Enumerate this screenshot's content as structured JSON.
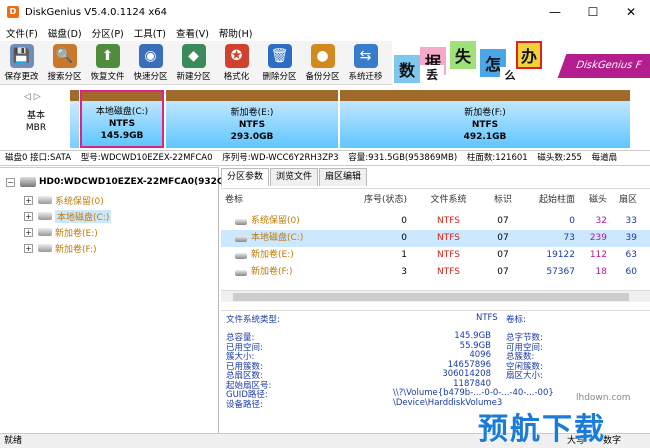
{
  "window": {
    "title": "DiskGenius V5.4.0.1124 x64",
    "app_icon": "D",
    "controls": [
      "—",
      "☐",
      "✕"
    ]
  },
  "menu": [
    "文件(F)",
    "磁盘(D)",
    "分区(P)",
    "工具(T)",
    "查看(V)",
    "帮助(H)"
  ],
  "toolbar": [
    {
      "label": "保存更改",
      "icon": "save-icon",
      "color": "#6f8fb8",
      "glyph": "💾"
    },
    {
      "label": "搜索分区",
      "icon": "magnifier-icon",
      "color": "#c9782c",
      "glyph": "🔍"
    },
    {
      "label": "恢复文件",
      "icon": "recover-icon",
      "color": "#4f8d3a",
      "glyph": "⬆"
    },
    {
      "label": "快速分区",
      "icon": "quick-partition-icon",
      "color": "#3a6fb8",
      "glyph": "◉"
    },
    {
      "label": "新建分区",
      "icon": "new-partition-icon",
      "color": "#3b8b5a",
      "glyph": "◆"
    },
    {
      "label": "格式化",
      "icon": "format-icon",
      "color": "#d0422e",
      "glyph": "✪"
    },
    {
      "label": "删除分区",
      "icon": "delete-icon",
      "color": "#2d6ec4",
      "glyph": "🗑"
    },
    {
      "label": "备份分区",
      "icon": "backup-icon",
      "color": "#d08a1e",
      "glyph": "●"
    },
    {
      "label": "系统迁移",
      "icon": "migrate-icon",
      "color": "#3a7ccc",
      "glyph": "⇆"
    }
  ],
  "banner": {
    "chars": [
      "数",
      "据",
      "丢",
      "失",
      "怎",
      "么",
      "办"
    ],
    "brand": "DiskGenius F"
  },
  "disk_strip": {
    "nav": "◁ ▷",
    "type": "基本",
    "style": "MBR",
    "partitions": [
      {
        "name": "本地磁盘(C:)",
        "fs": "NTFS",
        "size": "145.9GB",
        "selected": true
      },
      {
        "name": "新加卷(E:)",
        "fs": "NTFS",
        "size": "293.0GB",
        "selected": false
      },
      {
        "name": "新加卷(F:)",
        "fs": "NTFS",
        "size": "492.1GB",
        "selected": false
      }
    ]
  },
  "disk_info": [
    "磁盘0 接口:SATA",
    "型号:WDCWD10EZEX-22MFCA0",
    "序列号:WD-WCC6Y2RH3ZP3",
    "容量:931.5GB(953869MB)",
    "柱面数:121601",
    "磁头数:255",
    "每道扇"
  ],
  "tree": {
    "disk": "HD0:WDCWD10EZEX-22MFCA0(932G",
    "items": [
      {
        "label": "系统保留(0)",
        "color": "#c07800",
        "selected": false
      },
      {
        "label": "本地磁盘(C:)",
        "color": "#c07800",
        "selected": true
      },
      {
        "label": "新加卷(E:)",
        "color": "#c07800",
        "selected": false
      },
      {
        "label": "新加卷(F:)",
        "color": "#c07800",
        "selected": false
      }
    ]
  },
  "tabs": [
    "分区参数",
    "浏览文件",
    "扇区编辑"
  ],
  "grid": {
    "headers": [
      "卷标",
      "序号(状态)",
      "文件系统",
      "标识",
      "起始柱面",
      "磁头",
      "扇区"
    ],
    "rows": [
      {
        "label": "系统保留(0)",
        "num": "0",
        "fs": "NTFS",
        "id": "07",
        "cyl": "0",
        "head": "32",
        "sec": "33",
        "selected": false
      },
      {
        "label": "本地磁盘(C:)",
        "num": "0",
        "fs": "NTFS",
        "id": "07",
        "cyl": "73",
        "head": "239",
        "sec": "39",
        "selected": true
      },
      {
        "label": "新加卷(E:)",
        "num": "1",
        "fs": "NTFS",
        "id": "07",
        "cyl": "19122",
        "head": "112",
        "sec": "63",
        "selected": false
      },
      {
        "label": "新加卷(F:)",
        "num": "3",
        "fs": "NTFS",
        "id": "07",
        "cyl": "57367",
        "head": "18",
        "sec": "60",
        "selected": false
      }
    ]
  },
  "details": {
    "fs_label": "文件系统类型:",
    "fs_value": "NTFS",
    "vol_label": "卷标:",
    "left": [
      {
        "k": "总容量:",
        "v": "145.9GB"
      },
      {
        "k": "已用空间:",
        "v": "55.9GB"
      },
      {
        "k": "簇大小:",
        "v": "4096"
      },
      {
        "k": "已用簇数:",
        "v": "14657896"
      },
      {
        "k": "总扇区数:",
        "v": "306014208"
      },
      {
        "k": "起始扇区号:",
        "v": "1187840"
      }
    ],
    "right": [
      "总字节数:",
      "可用空间:",
      "总簇数:",
      "空闲簇数:",
      "扇区大小:"
    ],
    "guid_label": "GUID路径:",
    "guid_value": "\\\\?\\Volume{b479b-...-0-0-...-40-...-00}",
    "dev_label": "设备路径:",
    "dev_value": "\\Device\\HarddiskVolume3"
  },
  "status": {
    "left": "就绪",
    "mid": "大写",
    "right": "数字"
  },
  "watermark": {
    "text": "预航下载",
    "url": "lhdown.com"
  }
}
